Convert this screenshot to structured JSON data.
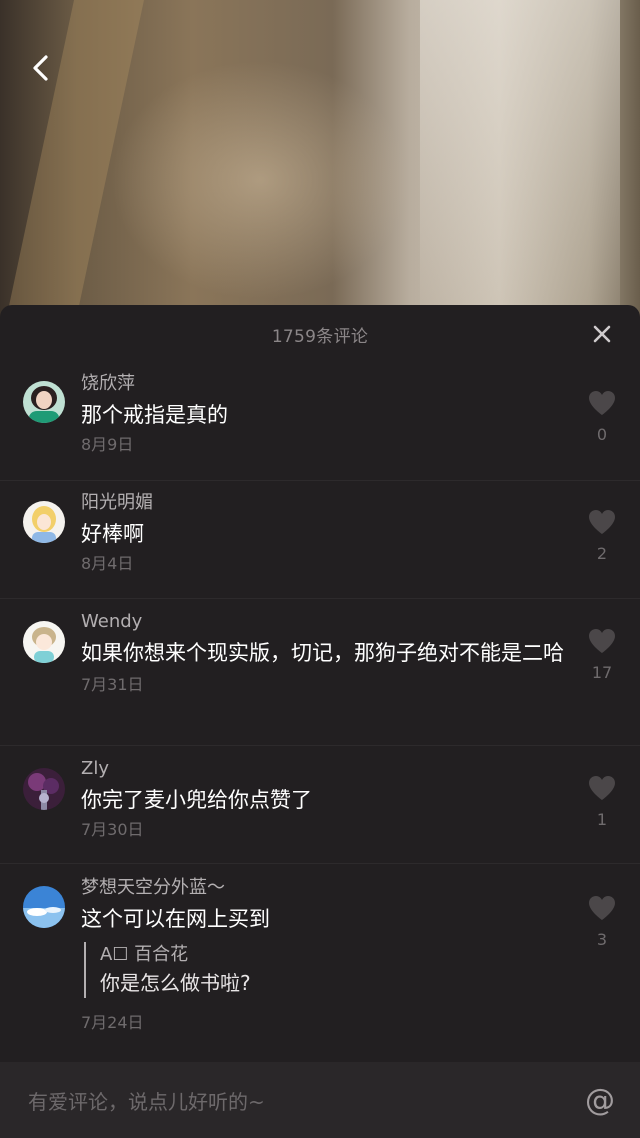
{
  "header": {
    "comment_count_title": "1759条评论"
  },
  "icons": {
    "back": "chevron-left-icon",
    "close": "close-icon",
    "like": "heart-icon",
    "mention": "at-icon"
  },
  "colors": {
    "sheet_bg": "#221f21",
    "text_primary": "#ffffff",
    "text_secondary": "#b3afb1",
    "text_muted": "#6f6b6d",
    "heart": "#4b4749"
  },
  "comments": [
    {
      "user": "饶欣萍",
      "text": "那个戒指是真的",
      "date": "8月9日",
      "likes": "0"
    },
    {
      "user": "阳光明媚",
      "text": "好棒啊",
      "date": "8月4日",
      "likes": "2"
    },
    {
      "user": "Wendy",
      "text": "如果你想来个现实版，切记，那狗子绝对不能是二哈",
      "date": "7月31日",
      "likes": "17"
    },
    {
      "user": "Zly",
      "text": "你完了麦小兜给你点赞了",
      "date": "7月30日",
      "likes": "1"
    },
    {
      "user": "梦想天空分外蓝～",
      "text": "这个可以在网上买到",
      "date": "7月24日",
      "likes": "3",
      "reply": {
        "user": "A☐ 百合花",
        "text": "你是怎么做书啦?"
      }
    }
  ],
  "input": {
    "placeholder": "有爱评论，说点儿好听的~",
    "mention_symbol": "@"
  }
}
